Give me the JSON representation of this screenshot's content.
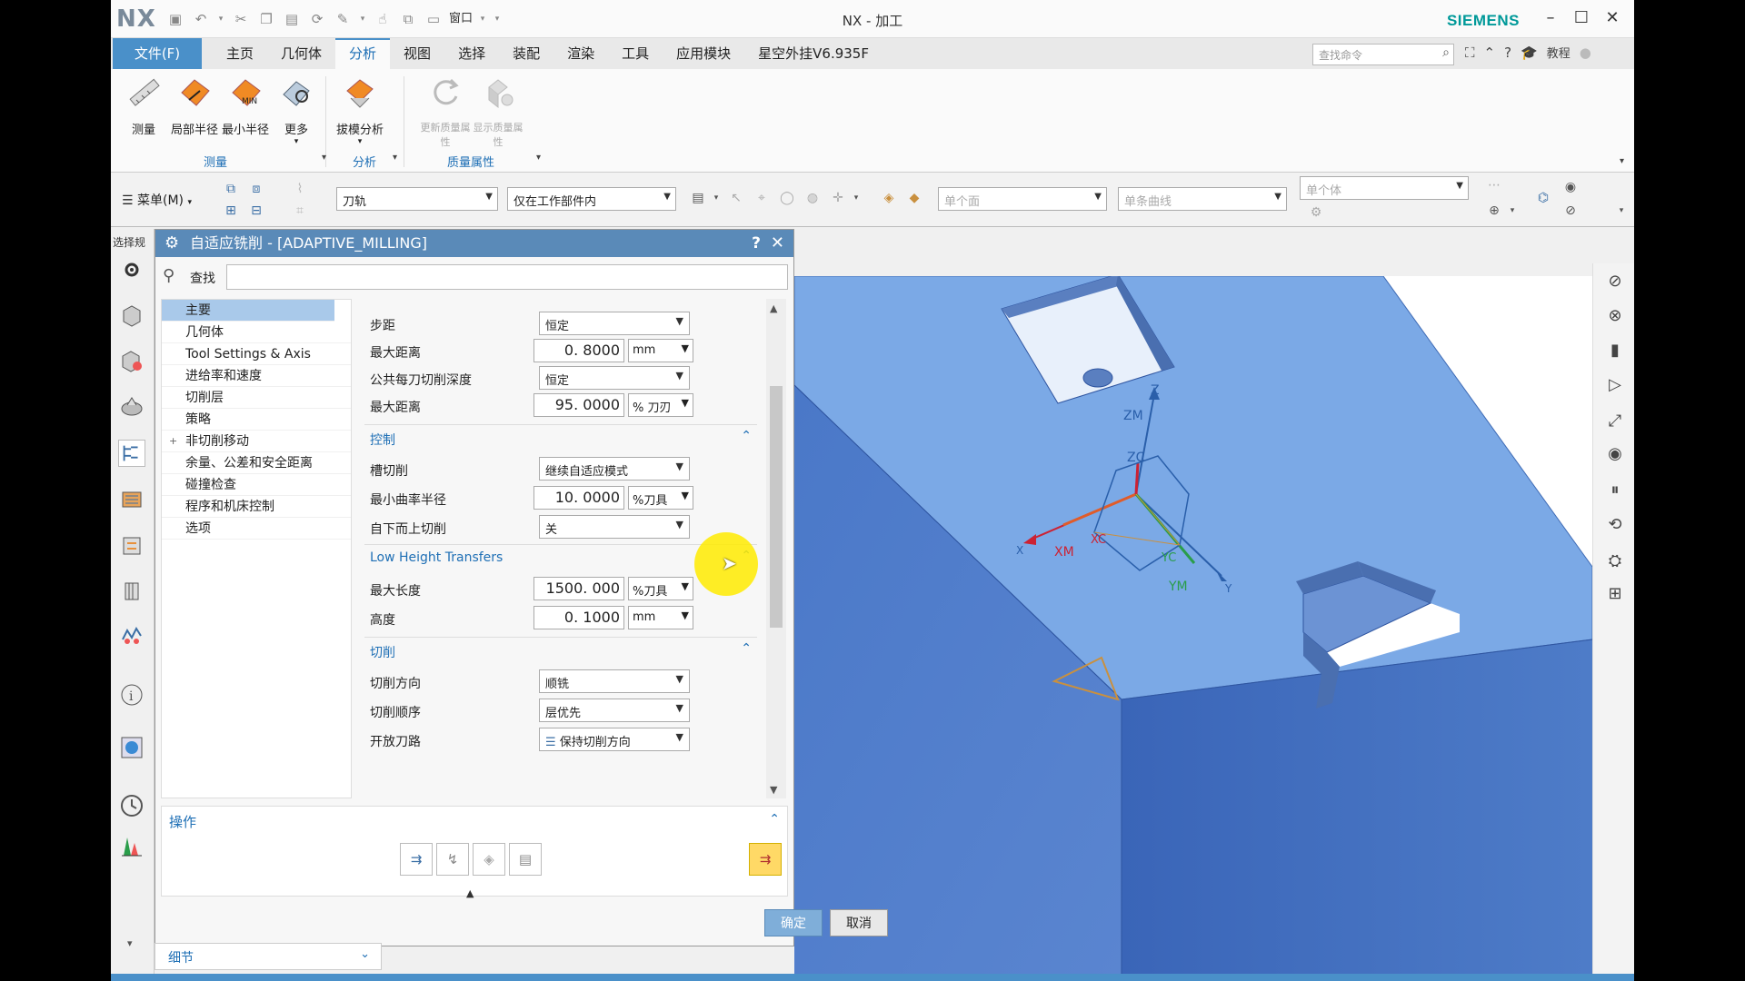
{
  "titlebar": {
    "logo": "NX",
    "window_menu": "窗口",
    "title": "NX - 加工",
    "brand": "SIEMENS"
  },
  "menubar": {
    "file": "文件(F)",
    "tabs": [
      "主页",
      "几何体",
      "分析",
      "视图",
      "选择",
      "装配",
      "渲染",
      "工具",
      "应用模块",
      "星空外挂V6.935F"
    ],
    "active_tab": "分析",
    "search_placeholder": "查找命令",
    "tutorial": "教程"
  },
  "ribbon": {
    "buttons": [
      {
        "label": "测量"
      },
      {
        "label": "局部半径"
      },
      {
        "label": "最小半径"
      },
      {
        "label": "更多"
      },
      {
        "label": "拔模分析"
      },
      {
        "label": "更新质量属性"
      },
      {
        "label": "显示质量属性"
      }
    ],
    "groups": [
      "测量",
      "分析",
      "质量属性"
    ]
  },
  "seltool": {
    "menu": "菜单(M)",
    "filter1": "刀轨",
    "filter2": "仅在工作部件内",
    "filter3": "单个面",
    "filter4": "单条曲线",
    "filter5": "单个体"
  },
  "resbar": {
    "label": "选择规"
  },
  "dialog": {
    "title": "自适应铣削 - [ADAPTIVE_MILLING]",
    "help": "?",
    "find_label": "查找",
    "tree": [
      {
        "label": "主要",
        "selected": true
      },
      {
        "label": "几何体"
      },
      {
        "label": "Tool Settings & Axis"
      },
      {
        "label": "进给率和速度"
      },
      {
        "label": "切削层"
      },
      {
        "label": "策略"
      },
      {
        "label": "非切削移动",
        "expandable": true
      },
      {
        "label": "余量、公差和安全距离"
      },
      {
        "label": "碰撞检查"
      },
      {
        "label": "程序和机床控制"
      },
      {
        "label": "选项"
      }
    ],
    "props": {
      "stepover_label": "步距",
      "stepover_value": "恒定",
      "maxdist1_label": "最大距离",
      "maxdist1_value": "0. 8000",
      "maxdist1_unit": "mm",
      "depth_label": "公共每刀切削深度",
      "depth_value": "恒定",
      "maxdist2_label": "最大距离",
      "maxdist2_value": "95. 0000",
      "maxdist2_unit": "% 刀刃",
      "control_section": "控制",
      "slot_label": "槽切削",
      "slot_value": "继续自适应模式",
      "minradius_label": "最小曲率半径",
      "minradius_value": "10. 0000",
      "minradius_unit": "%刀具",
      "bottomup_label": "自下而上切削",
      "bottomup_value": "关",
      "lht_section": "Low Height Transfers",
      "maxlen_label": "最大长度",
      "maxlen_value": "1500. 000",
      "maxlen_unit": "%刀具",
      "height_label": "高度",
      "height_value": "0. 1000",
      "height_unit": "mm",
      "cut_section": "切削",
      "cutdir_label": "切削方向",
      "cutdir_value": "顺铣",
      "cutorder_label": "切削顺序",
      "cutorder_value": "层优先",
      "open_label": "开放刀路",
      "open_value": "保持切削方向"
    },
    "ops_title": "操作",
    "ok": "确定",
    "cancel": "取消",
    "details": "细节"
  },
  "viewport": {
    "axes_labels": [
      "Z",
      "ZM",
      "ZC",
      "XM",
      "XC",
      "YC",
      "YM"
    ],
    "axes_x_label": "X",
    "axes_y_label": "Y",
    "part_color": "#7ba9e6"
  }
}
